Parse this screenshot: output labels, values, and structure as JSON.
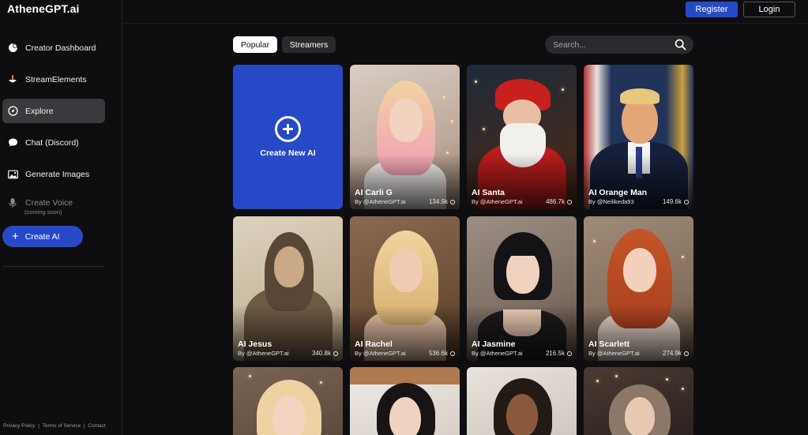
{
  "app": {
    "title": "AtheneGPT.ai"
  },
  "sidebar": {
    "items": [
      {
        "label": "Creator Dashboard",
        "icon": "pie-chart-icon"
      },
      {
        "label": "StreamElements",
        "icon": "streamelements-icon"
      },
      {
        "label": "Explore",
        "icon": "compass-icon"
      },
      {
        "label": "Chat (Discord)",
        "icon": "chat-bubble-icon"
      },
      {
        "label": "Generate Images",
        "icon": "image-icon"
      },
      {
        "label": "Create Voice",
        "icon": "microphone-icon",
        "sublabel": "(coming soon)"
      }
    ],
    "create_button": "Create AI",
    "footer": [
      "Privacy Policy",
      "|",
      "Terms of Service",
      "|",
      "Contact"
    ]
  },
  "header": {
    "register": "Register",
    "login": "Login"
  },
  "filters": {
    "tabs": [
      "Popular",
      "Streamers"
    ],
    "search_placeholder": "Search..."
  },
  "create_card": {
    "label": "Create New AI"
  },
  "cards": [
    {
      "name": "AI Carli G",
      "by": "By @AtheneGPT.ai",
      "count": "134.9k"
    },
    {
      "name": "AI Santa",
      "by": "By @AtheneGPT.ai",
      "count": "486.7k"
    },
    {
      "name": "AI Orange Man",
      "by": "By @Neilikeda93",
      "count": "149.6k"
    },
    {
      "name": "AI Jesus",
      "by": "By @AtheneGPT.ai",
      "count": "340.8k"
    },
    {
      "name": "AI Rachel",
      "by": "By @AtheneGPT.ai",
      "count": "536.6k"
    },
    {
      "name": "AI Jasmine",
      "by": "By @AtheneGPT.ai",
      "count": "216.5k"
    },
    {
      "name": "AI Scarlett",
      "by": "By @AtheneGPT.ai",
      "count": "274.9k"
    }
  ],
  "colors": {
    "accent": "#2849c7",
    "background": "#0e0e10",
    "active_nav": "#3a3a3e"
  }
}
